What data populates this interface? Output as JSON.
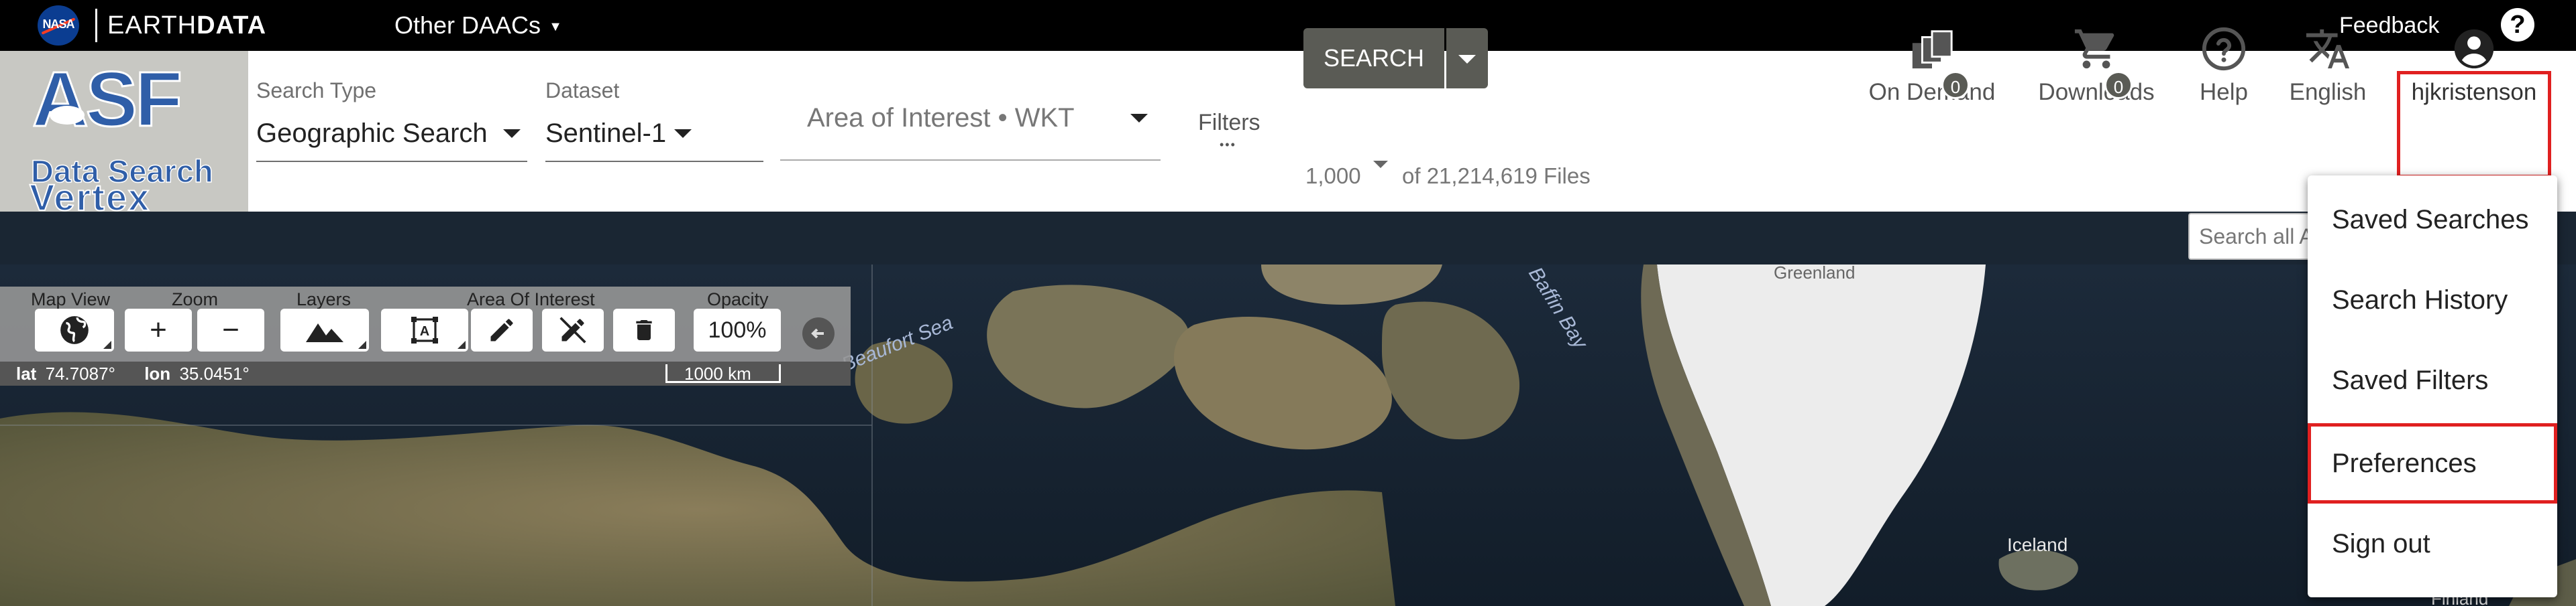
{
  "topbar": {
    "nasa_logo_text": "NASA",
    "earthdata_prefix": "EARTH",
    "earthdata_bold": "DATA",
    "other_daacs": "Other DAACs",
    "feedback": "Feedback",
    "help_icon": "?"
  },
  "logo": {
    "asf": "ASF",
    "data_search": "Data Search",
    "vertex": "Vertex"
  },
  "search": {
    "search_type_label": "Search Type",
    "search_type_value": "Geographic Search",
    "dataset_label": "Dataset",
    "dataset_value": "Sentinel-1",
    "aoi_placeholder": "Area of Interest • WKT",
    "filters_label": "Filters",
    "filters_dots": "•••",
    "search_button": "SEARCH",
    "max_results": "1,000",
    "results_suffix": "of 21,214,619 Files"
  },
  "header_nav": {
    "on_demand": {
      "label": "On Demand",
      "count": "0",
      "icon": "stacked-files-icon"
    },
    "downloads": {
      "label": "Downloads",
      "count": "0",
      "icon": "cart-icon"
    },
    "help": {
      "label": "Help",
      "icon": "help-circle-icon"
    },
    "language": {
      "label": "English",
      "icon": "translate-icon"
    },
    "user": {
      "label": "hjkristenson",
      "icon": "account-circle-icon"
    }
  },
  "search_all": {
    "placeholder": "Search all A"
  },
  "map_toolbar": {
    "map_view_label": "Map View",
    "zoom_label": "Zoom",
    "layers_label": "Layers",
    "aoi_label": "Area Of Interest",
    "opacity_label": "Opacity",
    "opacity_value": "100%",
    "zoom_in": "+",
    "zoom_out": "−"
  },
  "coords": {
    "lat_label": "lat",
    "lat_value": "74.7087°",
    "lon_label": "lon",
    "lon_value": "35.0451°",
    "scale": "1000 km"
  },
  "map_labels": {
    "beaufort_sea": "Beaufort Sea",
    "baffin_bay": "Baffin Bay",
    "greenland": "Greenland",
    "iceland": "Iceland",
    "finland": "Finland"
  },
  "user_menu": {
    "items": [
      "Saved Searches",
      "Search History",
      "Saved Filters",
      "Preferences",
      "Sign out"
    ]
  },
  "colors": {
    "topbar": "#000000",
    "header_gray": "#c8c8c3",
    "asf_blue": "#2f5ea8",
    "button_gray": "#5a5b55",
    "highlight_red": "#e02020"
  }
}
